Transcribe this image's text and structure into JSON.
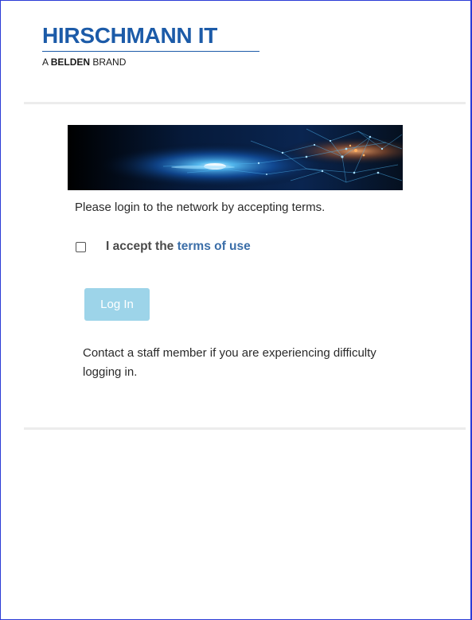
{
  "brand": {
    "name": "HIRSCHMANN IT",
    "sub_prefix": "A ",
    "sub_bold": "BELDEN",
    "sub_suffix": " BRAND",
    "color": "#1c5ba8"
  },
  "login": {
    "prompt": "Please login to the network by accepting terms.",
    "accept_text": "I accept the ",
    "terms_link": "terms of use",
    "accepted": false,
    "button_label": "Log In",
    "button_color": "#9dd4e9",
    "help_text": "Contact a staff member if you are experiencing difficulty logging in."
  }
}
